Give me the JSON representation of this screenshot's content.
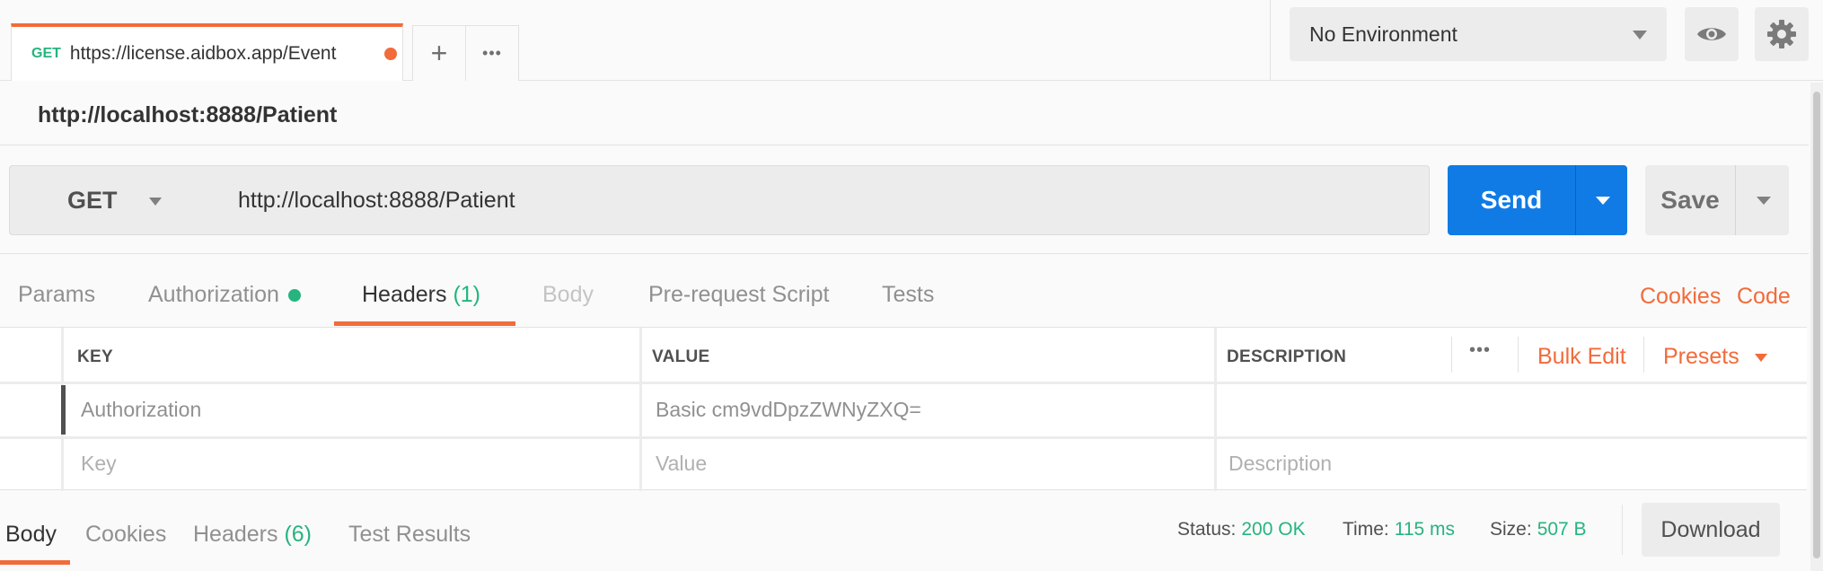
{
  "request_tab": {
    "method": "GET",
    "url": "https://license.aidbox.app/Event",
    "unsaved_indicator_color": "#f26b3a"
  },
  "tab_actions": {
    "add_label": "+",
    "more_label": "•••"
  },
  "environment": {
    "selected": "No Environment"
  },
  "request_title": "http://localhost:8888/Patient",
  "url_bar": {
    "method": "GET",
    "url": "http://localhost:8888/Patient",
    "send_label": "Send",
    "save_label": "Save"
  },
  "request_tabs": {
    "params": "Params",
    "authorization": "Authorization",
    "headers": "Headers",
    "headers_count": "(1)",
    "body": "Body",
    "pre_request": "Pre-request Script",
    "tests": "Tests",
    "cookies": "Cookies",
    "code": "Code"
  },
  "headers_table": {
    "columns": {
      "key": "KEY",
      "value": "VALUE",
      "description": "DESCRIPTION"
    },
    "more_label": "•••",
    "bulk_edit": "Bulk Edit",
    "presets": "Presets",
    "rows": [
      {
        "key": "Authorization",
        "value": "Basic cm9vdDpzZWNyZXQ=",
        "description": ""
      }
    ],
    "new_row": {
      "key_placeholder": "Key",
      "value_placeholder": "Value",
      "description_placeholder": "Description"
    }
  },
  "response_tabs": {
    "body": "Body",
    "cookies": "Cookies",
    "headers": "Headers",
    "headers_count": "(6)",
    "test_results": "Test Results"
  },
  "response_status": {
    "status_label": "Status:",
    "status_value": "200 OK",
    "time_label": "Time:",
    "time_value": "115 ms",
    "size_label": "Size:",
    "size_value": "507 B",
    "download_label": "Download"
  },
  "colors": {
    "accent": "#f26b3a",
    "primary": "#107be5",
    "success": "#26b47f"
  }
}
